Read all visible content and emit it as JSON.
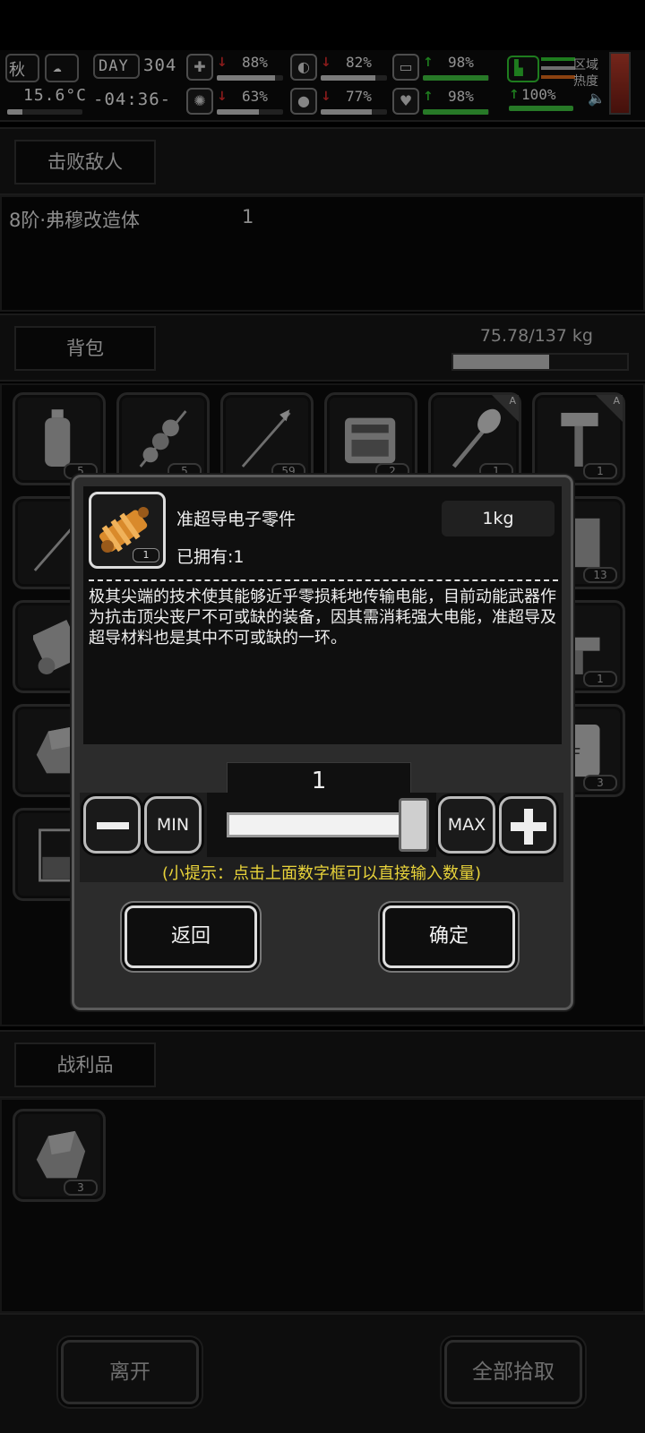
{
  "hud": {
    "season": "秋",
    "temperature": "15.6°C",
    "day_label": "DAY",
    "day_value": "304",
    "time": "-04:36-",
    "stats": [
      {
        "name": "health",
        "icon": "medkit-icon",
        "trend": "down",
        "value": "88%",
        "level": 0.88
      },
      {
        "name": "hunger",
        "icon": "stomach-icon",
        "trend": "down",
        "value": "82%",
        "level": 0.82
      },
      {
        "name": "stamina",
        "icon": "capsule-icon",
        "trend": "up",
        "value": "98%",
        "level": 0.98
      },
      {
        "name": "sanity",
        "icon": "brain-icon",
        "trend": "down",
        "value": "63%",
        "level": 0.63
      },
      {
        "name": "thirst",
        "icon": "water-drop-icon",
        "trend": "down",
        "value": "77%",
        "level": 0.77
      },
      {
        "name": "mood",
        "icon": "heart-icon",
        "trend": "up",
        "value": "98%",
        "level": 0.98
      }
    ],
    "boot": {
      "trend": "up",
      "value": "100%",
      "level": 1.0
    },
    "area_heat_label": "区域热度",
    "colors": {
      "down": "#d42a2a",
      "up": "#2fbf2f"
    }
  },
  "defeated": {
    "tab_label": "击败敌人",
    "enemies": [
      {
        "name": "8阶·弗穆改造体",
        "count": "1"
      }
    ]
  },
  "backpack": {
    "tab_label": "背包",
    "weight_text": "75.78/137 kg",
    "weight_fraction": 0.553,
    "slots": [
      {
        "item": "water-bottle-icon",
        "qty": "5"
      },
      {
        "item": "skewer-icon",
        "qty": "5"
      },
      {
        "item": "arrow-icon",
        "qty": "59"
      },
      {
        "item": "toolbox-icon",
        "qty": "2"
      },
      {
        "item": "shovel-icon",
        "qty": "1",
        "badge": "A"
      },
      {
        "item": "hammer-icon",
        "qty": "1",
        "badge": "A"
      },
      {
        "item": "arrow-icon",
        "qty": ""
      },
      {
        "item": "cloth-icon",
        "qty": "13"
      },
      {
        "item": "paper-roll-icon",
        "qty": ""
      },
      {
        "item": "turret-icon",
        "qty": "1"
      },
      {
        "item": "ore-icon",
        "qty": ""
      },
      {
        "item": "bag-icon",
        "qty": "3"
      },
      {
        "item": "beaker-icon",
        "qty": ""
      }
    ]
  },
  "loot": {
    "tab_label": "战利品",
    "slots": [
      {
        "item": "ore-icon",
        "qty": "3"
      }
    ]
  },
  "bottom": {
    "leave_label": "离开",
    "pickup_all_label": "全部拾取"
  },
  "dialog": {
    "item_name": "准超导电子零件",
    "item_weight": "1kg",
    "owned": "已拥有:1",
    "icon_qty": "1",
    "description": "极其尖端的技术使其能够近乎零损耗地传输电能，目前动能武器作为抗击顶尖丧尸不可或缺的装备，因其需消耗强大电能，准超导及超导材料也是其中不可或缺的一环。",
    "quantity": "1",
    "slider_fraction": 1.0,
    "min_label": "MIN",
    "max_label": "MAX",
    "tip": "(小提示：点击上面数字框可以直接输入数量)",
    "back_label": "返回",
    "confirm_label": "确定",
    "tip_color": "#e8d33a"
  }
}
